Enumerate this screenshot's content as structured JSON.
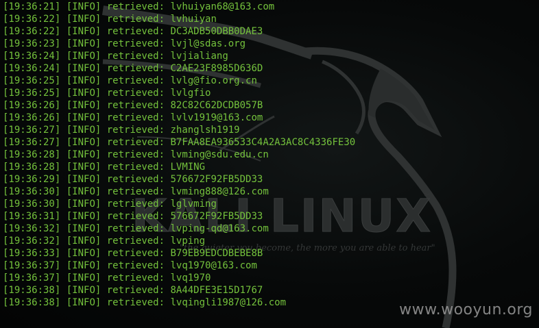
{
  "wallpaper": {
    "logo_text": "KALI LINUX",
    "trademark": "™",
    "tagline": "\"the quieter you become, the more you are able to hear\""
  },
  "watermark": "www.wooyun.org",
  "log_lines": [
    {
      "time": "[19:36:21]",
      "level": "[INFO]",
      "message": "retrieved: lvhuiyan68@163.com"
    },
    {
      "time": "[19:36:22]",
      "level": "[INFO]",
      "message": "retrieved: lvhuiyan"
    },
    {
      "time": "[19:36:22]",
      "level": "[INFO]",
      "message": "retrieved: DC3ADB50DBB0DAE3"
    },
    {
      "time": "[19:36:23]",
      "level": "[INFO]",
      "message": "retrieved: lvjl@sdas.org"
    },
    {
      "time": "[19:36:24]",
      "level": "[INFO]",
      "message": "retrieved: lvjialiang"
    },
    {
      "time": "[19:36:24]",
      "level": "[INFO]",
      "message": "retrieved: C2AE23F8985D636D"
    },
    {
      "time": "[19:36:25]",
      "level": "[INFO]",
      "message": "retrieved: lvlg@fio.org.cn"
    },
    {
      "time": "[19:36:25]",
      "level": "[INFO]",
      "message": "retrieved: lvlgfio"
    },
    {
      "time": "[19:36:26]",
      "level": "[INFO]",
      "message": "retrieved: 82C82C62DCDB057B"
    },
    {
      "time": "[19:36:26]",
      "level": "[INFO]",
      "message": "retrieved: lvlv1919@163.com"
    },
    {
      "time": "[19:36:27]",
      "level": "[INFO]",
      "message": "retrieved: zhanglsh1919"
    },
    {
      "time": "[19:36:27]",
      "level": "[INFO]",
      "message": "retrieved: B7FAA8EA936533C4A2A3AC8C4336FE30"
    },
    {
      "time": "[19:36:28]",
      "level": "[INFO]",
      "message": "retrieved: lvming@sdu.edu.cn"
    },
    {
      "time": "[19:36:28]",
      "level": "[INFO]",
      "message": "retrieved: LVMING"
    },
    {
      "time": "[19:36:29]",
      "level": "[INFO]",
      "message": "retrieved: 576672F92FB5DD33"
    },
    {
      "time": "[19:36:30]",
      "level": "[INFO]",
      "message": "retrieved: lvming888@126.com"
    },
    {
      "time": "[19:36:30]",
      "level": "[INFO]",
      "message": "retrieved: lglvming"
    },
    {
      "time": "[19:36:31]",
      "level": "[INFO]",
      "message": "retrieved: 576672F92FB5DD33"
    },
    {
      "time": "[19:36:32]",
      "level": "[INFO]",
      "message": "retrieved: lvping-qd@163.com"
    },
    {
      "time": "[19:36:32]",
      "level": "[INFO]",
      "message": "retrieved: lvping"
    },
    {
      "time": "[19:36:33]",
      "level": "[INFO]",
      "message": "retrieved: B79EB9EDCDBEBE8B"
    },
    {
      "time": "[19:36:37]",
      "level": "[INFO]",
      "message": "retrieved: lvq1970@163.com"
    },
    {
      "time": "[19:36:37]",
      "level": "[INFO]",
      "message": "retrieved: lvq1970"
    },
    {
      "time": "[19:36:38]",
      "level": "[INFO]",
      "message": "retrieved: 8A44DFE3E15D1767"
    },
    {
      "time": "[19:36:38]",
      "level": "[INFO]",
      "message": "retrieved: lvqingli1987@126.com"
    }
  ],
  "colors": {
    "terminal_text": "#74c23c",
    "background": "#050707",
    "watermark": "#9a9a9a"
  }
}
